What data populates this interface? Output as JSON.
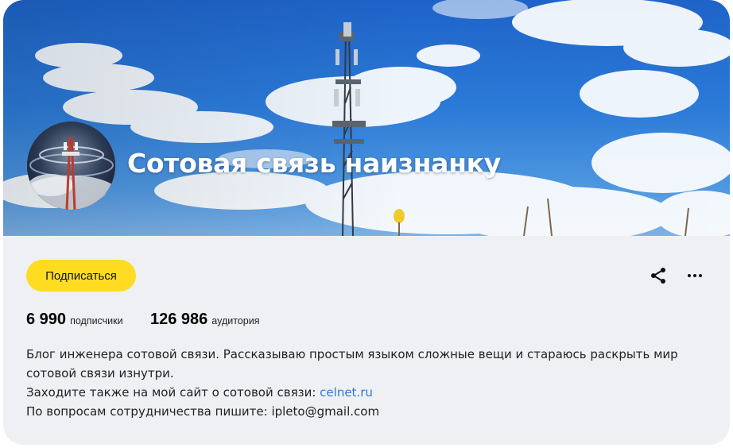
{
  "channel": {
    "title": "Сотовая связь наизнанку",
    "subscribe_label": "Подписаться"
  },
  "actions": {
    "share_icon": "share-icon",
    "more_icon": "more-icon"
  },
  "stats": {
    "subscribers_value": "6 990",
    "subscribers_label": "подписчики",
    "audience_value": "126 986",
    "audience_label": "аудитория"
  },
  "description": {
    "line1": "Блог инженера сотовой связи. Рассказываю простым языком сложные вещи и стараюсь раскрыть мир сотовой связи изнутри.",
    "line2_prefix": "Заходите также на мой сайт о сотовой связи: ",
    "site_link": "celnet.ru",
    "line3": "По вопросам сотрудничества пишите: ipleto@gmail.com"
  },
  "colors": {
    "subscribe_button": "#ffdc22",
    "link": "#2b79d8",
    "panel_background": "#eff0f3"
  }
}
